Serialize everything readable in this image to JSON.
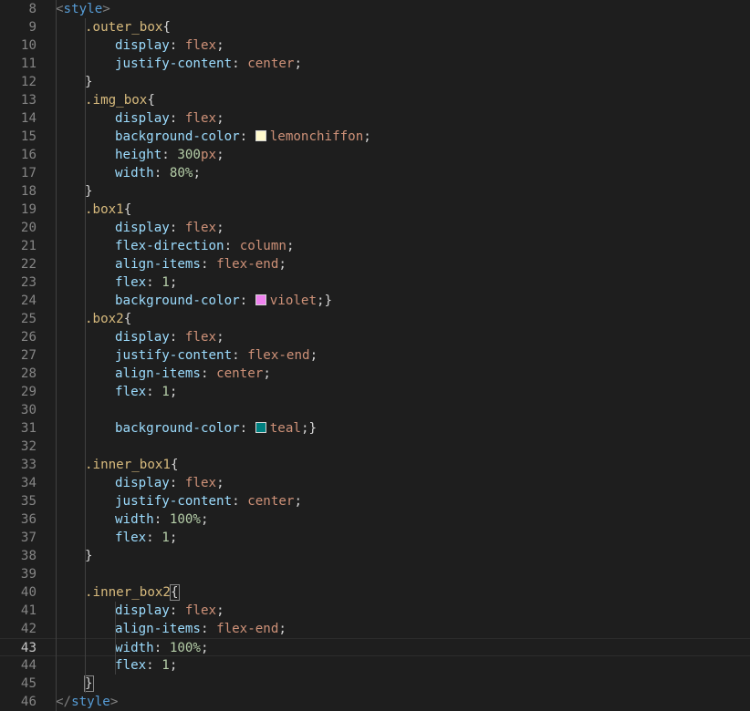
{
  "editor": {
    "language": "css",
    "current_line": 43,
    "colors": {
      "background": "#1e1e1e",
      "tag": "#569cd6",
      "selector": "#d7ba7d",
      "property": "#9cdcfe",
      "value": "#ce9178",
      "number": "#b5cea8"
    },
    "lines": [
      {
        "n": "8",
        "indent": 1,
        "tokens": [
          {
            "t": "<",
            "c": "punc"
          },
          {
            "t": "style",
            "c": "tag"
          },
          {
            "t": ">",
            "c": "punc"
          }
        ]
      },
      {
        "n": "9",
        "indent": 2,
        "tokens": [
          {
            "t": ".outer_box",
            "c": "sel"
          },
          {
            "t": "{",
            "c": "brace"
          }
        ]
      },
      {
        "n": "10",
        "indent": 3,
        "tokens": [
          {
            "t": "display",
            "c": "prop"
          },
          {
            "t": ": ",
            "c": "text"
          },
          {
            "t": "flex",
            "c": "val"
          },
          {
            "t": ";",
            "c": "text"
          }
        ]
      },
      {
        "n": "11",
        "indent": 3,
        "tokens": [
          {
            "t": "justify-content",
            "c": "prop"
          },
          {
            "t": ": ",
            "c": "text"
          },
          {
            "t": "center",
            "c": "val"
          },
          {
            "t": ";",
            "c": "text"
          }
        ]
      },
      {
        "n": "12",
        "indent": 2,
        "tokens": [
          {
            "t": "}",
            "c": "brace"
          }
        ]
      },
      {
        "n": "13",
        "indent": 2,
        "tokens": [
          {
            "t": ".img_box",
            "c": "sel"
          },
          {
            "t": "{",
            "c": "brace"
          }
        ]
      },
      {
        "n": "14",
        "indent": 3,
        "tokens": [
          {
            "t": "display",
            "c": "prop"
          },
          {
            "t": ": ",
            "c": "text"
          },
          {
            "t": "flex",
            "c": "val"
          },
          {
            "t": ";",
            "c": "text"
          }
        ]
      },
      {
        "n": "15",
        "indent": 3,
        "tokens": [
          {
            "t": "background-color",
            "c": "prop"
          },
          {
            "t": ": ",
            "c": "text"
          },
          {
            "swatch": "#fffacd"
          },
          {
            "t": "lemonchiffon",
            "c": "val"
          },
          {
            "t": ";",
            "c": "text"
          }
        ]
      },
      {
        "n": "16",
        "indent": 3,
        "tokens": [
          {
            "t": "height",
            "c": "prop"
          },
          {
            "t": ": ",
            "c": "text"
          },
          {
            "t": "300",
            "c": "num"
          },
          {
            "t": "px",
            "c": "val"
          },
          {
            "t": ";",
            "c": "text"
          }
        ]
      },
      {
        "n": "17",
        "indent": 3,
        "tokens": [
          {
            "t": "width",
            "c": "prop"
          },
          {
            "t": ": ",
            "c": "text"
          },
          {
            "t": "80%",
            "c": "num"
          },
          {
            "t": ";",
            "c": "text"
          }
        ]
      },
      {
        "n": "18",
        "indent": 2,
        "tokens": [
          {
            "t": "}",
            "c": "brace"
          }
        ]
      },
      {
        "n": "19",
        "indent": 2,
        "tokens": [
          {
            "t": ".box1",
            "c": "sel"
          },
          {
            "t": "{",
            "c": "brace"
          }
        ]
      },
      {
        "n": "20",
        "indent": 3,
        "tokens": [
          {
            "t": "display",
            "c": "prop"
          },
          {
            "t": ": ",
            "c": "text"
          },
          {
            "t": "flex",
            "c": "val"
          },
          {
            "t": ";",
            "c": "text"
          }
        ]
      },
      {
        "n": "21",
        "indent": 3,
        "tokens": [
          {
            "t": "flex-direction",
            "c": "prop"
          },
          {
            "t": ": ",
            "c": "text"
          },
          {
            "t": "column",
            "c": "val"
          },
          {
            "t": ";",
            "c": "text"
          }
        ]
      },
      {
        "n": "22",
        "indent": 3,
        "tokens": [
          {
            "t": "align-items",
            "c": "prop"
          },
          {
            "t": ": ",
            "c": "text"
          },
          {
            "t": "flex-end",
            "c": "val"
          },
          {
            "t": ";",
            "c": "text"
          }
        ]
      },
      {
        "n": "23",
        "indent": 3,
        "tokens": [
          {
            "t": "flex",
            "c": "prop"
          },
          {
            "t": ": ",
            "c": "text"
          },
          {
            "t": "1",
            "c": "num"
          },
          {
            "t": ";",
            "c": "text"
          }
        ]
      },
      {
        "n": "24",
        "indent": 3,
        "tokens": [
          {
            "t": "background-color",
            "c": "prop"
          },
          {
            "t": ": ",
            "c": "text"
          },
          {
            "swatch": "#ee82ee"
          },
          {
            "t": "violet",
            "c": "val"
          },
          {
            "t": ";}",
            "c": "text"
          }
        ]
      },
      {
        "n": "25",
        "indent": 2,
        "tokens": [
          {
            "t": ".box2",
            "c": "sel"
          },
          {
            "t": "{",
            "c": "brace"
          }
        ]
      },
      {
        "n": "26",
        "indent": 3,
        "tokens": [
          {
            "t": "display",
            "c": "prop"
          },
          {
            "t": ": ",
            "c": "text"
          },
          {
            "t": "flex",
            "c": "val"
          },
          {
            "t": ";",
            "c": "text"
          }
        ]
      },
      {
        "n": "27",
        "indent": 3,
        "tokens": [
          {
            "t": "justify-content",
            "c": "prop"
          },
          {
            "t": ": ",
            "c": "text"
          },
          {
            "t": "flex-end",
            "c": "val"
          },
          {
            "t": ";",
            "c": "text"
          }
        ]
      },
      {
        "n": "28",
        "indent": 3,
        "tokens": [
          {
            "t": "align-items",
            "c": "prop"
          },
          {
            "t": ": ",
            "c": "text"
          },
          {
            "t": "center",
            "c": "val"
          },
          {
            "t": ";",
            "c": "text"
          }
        ]
      },
      {
        "n": "29",
        "indent": 3,
        "tokens": [
          {
            "t": "flex",
            "c": "prop"
          },
          {
            "t": ": ",
            "c": "text"
          },
          {
            "t": "1",
            "c": "num"
          },
          {
            "t": ";",
            "c": "text"
          }
        ]
      },
      {
        "n": "30",
        "indent": 3,
        "tokens": []
      },
      {
        "n": "31",
        "indent": 3,
        "tokens": [
          {
            "t": "background-color",
            "c": "prop"
          },
          {
            "t": ": ",
            "c": "text"
          },
          {
            "swatch": "#008080"
          },
          {
            "t": "teal",
            "c": "val"
          },
          {
            "t": ";}",
            "c": "text"
          }
        ]
      },
      {
        "n": "32",
        "indent": 2,
        "tokens": []
      },
      {
        "n": "33",
        "indent": 2,
        "tokens": [
          {
            "t": ".inner_box1",
            "c": "sel"
          },
          {
            "t": "{",
            "c": "brace"
          }
        ]
      },
      {
        "n": "34",
        "indent": 3,
        "tokens": [
          {
            "t": "display",
            "c": "prop"
          },
          {
            "t": ": ",
            "c": "text"
          },
          {
            "t": "flex",
            "c": "val"
          },
          {
            "t": ";",
            "c": "text"
          }
        ]
      },
      {
        "n": "35",
        "indent": 3,
        "tokens": [
          {
            "t": "justify-content",
            "c": "prop"
          },
          {
            "t": ": ",
            "c": "text"
          },
          {
            "t": "center",
            "c": "val"
          },
          {
            "t": ";",
            "c": "text"
          }
        ]
      },
      {
        "n": "36",
        "indent": 3,
        "tokens": [
          {
            "t": "width",
            "c": "prop"
          },
          {
            "t": ": ",
            "c": "text"
          },
          {
            "t": "100%",
            "c": "num"
          },
          {
            "t": ";",
            "c": "text"
          }
        ]
      },
      {
        "n": "37",
        "indent": 3,
        "tokens": [
          {
            "t": "flex",
            "c": "prop"
          },
          {
            "t": ": ",
            "c": "text"
          },
          {
            "t": "1",
            "c": "num"
          },
          {
            "t": ";",
            "c": "text"
          }
        ]
      },
      {
        "n": "38",
        "indent": 2,
        "tokens": [
          {
            "t": "}",
            "c": "brace"
          }
        ]
      },
      {
        "n": "39",
        "indent": 2,
        "tokens": []
      },
      {
        "n": "40",
        "indent": 2,
        "tokens": [
          {
            "t": ".inner_box2",
            "c": "sel"
          },
          {
            "t": "{",
            "c": "brace",
            "matched": true
          }
        ]
      },
      {
        "n": "41",
        "indent": 3,
        "tokens": [
          {
            "t": "display",
            "c": "prop"
          },
          {
            "t": ": ",
            "c": "text"
          },
          {
            "t": "flex",
            "c": "val"
          },
          {
            "t": ";",
            "c": "text"
          }
        ]
      },
      {
        "n": "42",
        "indent": 3,
        "tokens": [
          {
            "t": "align-items",
            "c": "prop"
          },
          {
            "t": ": ",
            "c": "text"
          },
          {
            "t": "flex-end",
            "c": "val"
          },
          {
            "t": ";",
            "c": "text"
          }
        ]
      },
      {
        "n": "43",
        "indent": 3,
        "tokens": [
          {
            "t": "width",
            "c": "prop"
          },
          {
            "t": ": ",
            "c": "text"
          },
          {
            "t": "100%",
            "c": "num"
          },
          {
            "t": ";",
            "c": "text"
          }
        ]
      },
      {
        "n": "44",
        "indent": 3,
        "tokens": [
          {
            "t": "flex",
            "c": "prop"
          },
          {
            "t": ": ",
            "c": "text"
          },
          {
            "t": "1",
            "c": "num"
          },
          {
            "t": ";",
            "c": "text"
          }
        ]
      },
      {
        "n": "45",
        "indent": 2,
        "tokens": [
          {
            "t": "}",
            "c": "brace",
            "matched": true
          }
        ]
      },
      {
        "n": "46",
        "indent": 1,
        "tokens": [
          {
            "t": "</",
            "c": "punc"
          },
          {
            "t": "style",
            "c": "tag"
          },
          {
            "t": ">",
            "c": "punc"
          }
        ]
      }
    ]
  }
}
